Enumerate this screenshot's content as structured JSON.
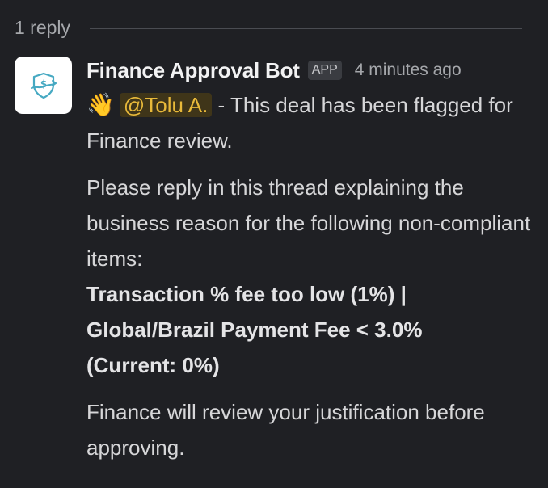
{
  "thread": {
    "reply_count": "1 reply"
  },
  "message": {
    "sender": "Finance Approval Bot",
    "badge": "APP",
    "timestamp": "4 minutes ago",
    "avatar_icon": "finance-shield-icon",
    "wave_emoji": "👋",
    "mention": "@Tolu A.",
    "intro_text": " - This deal has been flagged for Finance review.",
    "request_text": "Please reply in this thread explaining the business reason for the following non-compliant items:",
    "issue_line_1": "Transaction % fee too low (1%) |",
    "issue_line_2": "Global/Brazil Payment Fee < 3.0%",
    "issue_line_3": "(Current: 0%)",
    "closing_text": "Finance will review your justification before approving."
  },
  "colors": {
    "background": "#1f2024",
    "mention_bg": "#3f3519",
    "mention_text": "#e8b93a",
    "avatar_accent": "#46a9c2"
  }
}
